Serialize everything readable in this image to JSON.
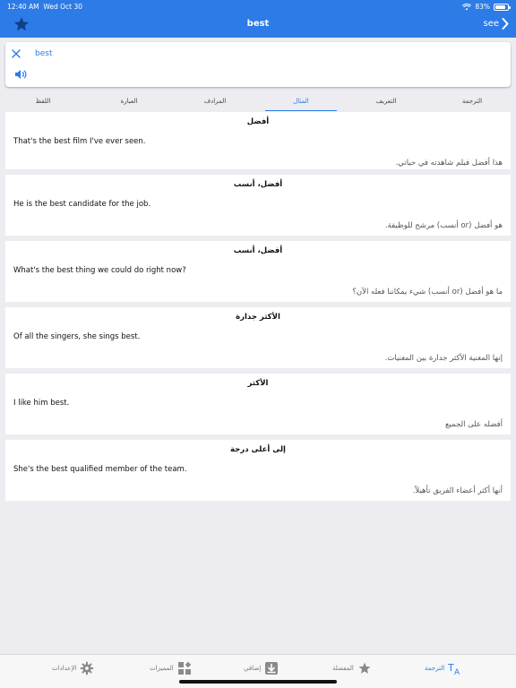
{
  "status": {
    "time": "12:40 AM",
    "date": "Wed Oct 30",
    "battery": "83%"
  },
  "nav": {
    "title": "best",
    "see": "see"
  },
  "search": {
    "value": "best"
  },
  "tabs": [
    "الترجمة",
    "التعريف",
    "المثال",
    "المرادف",
    "العبارة",
    "اللفظ"
  ],
  "active_tab": "المثال",
  "examples": [
    {
      "head": "أفضل",
      "en": "That's the best film I've ever seen.",
      "ar": "هذا أفضل فيلم شاهدته في حياتي."
    },
    {
      "head": "أفضل، أنسب",
      "en": "He is the best candidate for the job.",
      "ar": "هو أفضل (or أنسب) مرشح للوظيفة."
    },
    {
      "head": "أفضل، أنسب",
      "en": "What's the best thing we could do right now?",
      "ar": "ما هو أفضل (or أنسب) شيء يمكاننا فعله الآن؟"
    },
    {
      "head": "الأكثر جدارة",
      "en": "Of all the singers, she sings best.",
      "ar": "إنها المغنية الأكثر جدارة بين المغنيات."
    },
    {
      "head": "الأكثر",
      "en": "I like him best.",
      "ar": "أفضله على الجميع"
    },
    {
      "head": "إلى أعلى درجة",
      "en": "She's the best qualified member of the team.",
      "ar": "أنها أكثر أعضاء الفريق تأهيلاً."
    }
  ],
  "tabbar": {
    "translate": "الترجمة",
    "favorites": "المفضلة",
    "extra": "إضافي",
    "features": "المميزات",
    "settings": "الإعدادات"
  },
  "colors": {
    "accent": "#2d7be6",
    "background": "#ececf1"
  },
  "icons": [
    "star-icon",
    "chevron-right-icon",
    "close-icon",
    "speaker-icon",
    "translate-icon",
    "star-icon",
    "download-icon",
    "features-icon",
    "gear-icon"
  ]
}
